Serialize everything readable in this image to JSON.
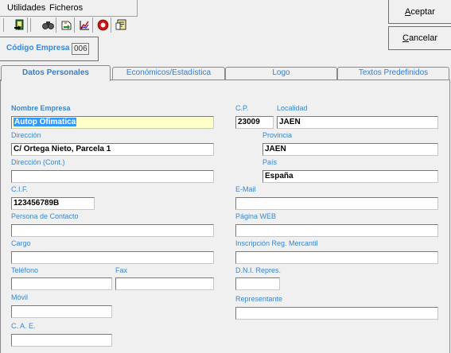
{
  "menu": {
    "items": [
      {
        "label": "Utilidades"
      },
      {
        "label": "Ficheros"
      }
    ]
  },
  "toolbar": {
    "icons": [
      "exit-icon",
      "binoculars-icon",
      "import-icon",
      "chart-icon",
      "stop-icon",
      "notes-icon"
    ]
  },
  "buttons": {
    "accept": "Aceptar",
    "cancel": "Cancelar"
  },
  "empresa": {
    "label": "Código Empresa",
    "value": "006"
  },
  "tabs": [
    {
      "label": "Datos Personales",
      "active": true
    },
    {
      "label": "Económicos/Estadística",
      "active": false
    },
    {
      "label": "Logo",
      "active": false
    },
    {
      "label": "Textos Predefinidos",
      "active": false
    }
  ],
  "form": {
    "nombre_empresa": {
      "label": "Nombre Empresa",
      "value": "Autop Ofimatica"
    },
    "direccion": {
      "label": "Dirección",
      "value": "C/ Ortega Nieto, Parcela 1"
    },
    "direccion_cont": {
      "label": "Dirección (Cont.)",
      "value": ""
    },
    "cif": {
      "label": "C.I.F.",
      "value": "123456789B"
    },
    "persona_contacto": {
      "label": "Persona de Contacto",
      "value": ""
    },
    "cargo": {
      "label": "Cargo",
      "value": ""
    },
    "telefono": {
      "label": "Teléfono",
      "value": ""
    },
    "fax": {
      "label": "Fax",
      "value": ""
    },
    "movil": {
      "label": "Móvil",
      "value": ""
    },
    "cae": {
      "label": "C. A. E.",
      "value": ""
    },
    "cp": {
      "label": "C.P.",
      "value": "23009"
    },
    "localidad": {
      "label": "Localidad",
      "value": "JAEN"
    },
    "provincia": {
      "label": "Provincia",
      "value": "JAEN"
    },
    "pais": {
      "label": "País",
      "value": "España"
    },
    "email": {
      "label": "E-Mail",
      "value": ""
    },
    "web": {
      "label": "Página WEB",
      "value": ""
    },
    "inscripcion": {
      "label": "Inscripción Reg. Mercantil",
      "value": ""
    },
    "dni_repres": {
      "label": "D.N.I. Repres.",
      "value": ""
    },
    "representante": {
      "label": "Representante",
      "value": ""
    }
  }
}
